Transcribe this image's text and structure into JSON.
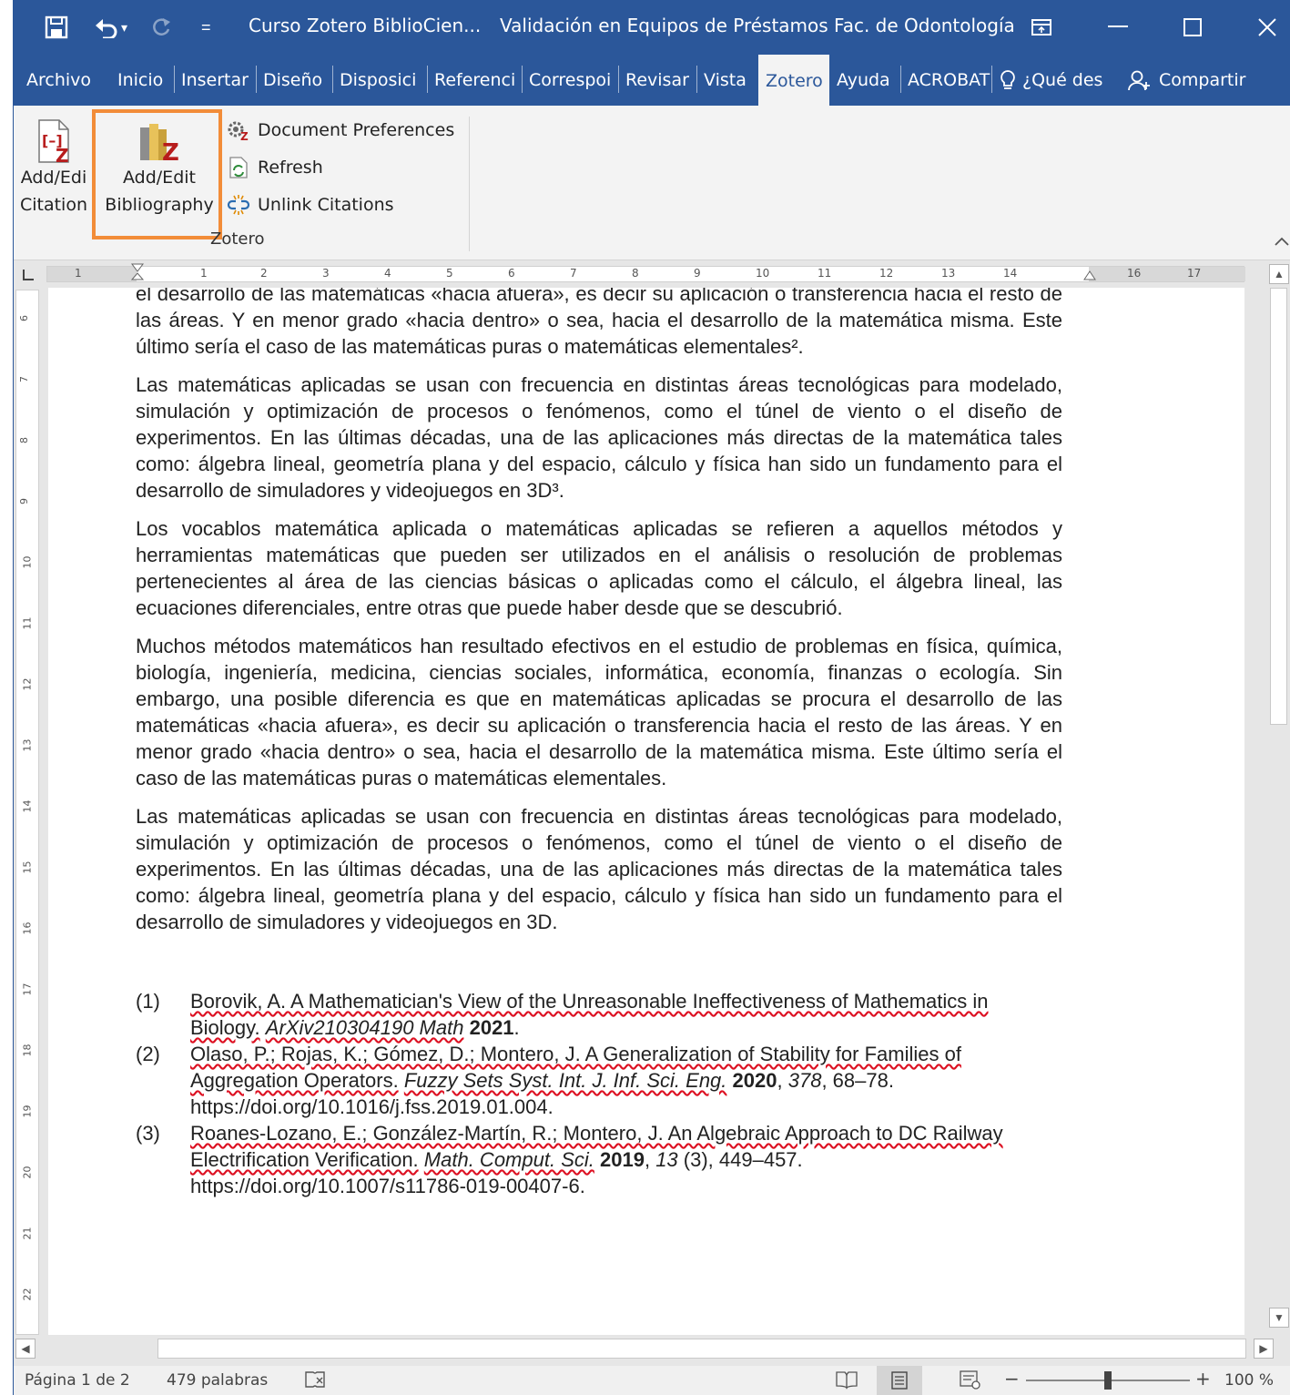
{
  "window": {
    "quick_access": {
      "undo_arrow": "▾",
      "customize": "="
    },
    "doc_title_1": "Curso Zotero BiblioCien...",
    "doc_title_2": "Validación en Equipos de Préstamos Fac. de Odontología",
    "colors": {
      "title_bar": "#2b579a",
      "highlight": "#f28c38"
    }
  },
  "tabs": [
    "Archivo",
    "Inicio",
    "Insertar",
    "Diseño",
    "Disposici",
    "Referenci",
    "Correspoi",
    "Revisar",
    "Vista",
    "Zotero",
    "Ayuda",
    "ACROBAT"
  ],
  "active_tab": "Zotero",
  "tell_me": "¿Qué des",
  "share": "Compartir",
  "ribbon": {
    "add_citation_l1": "Add/Edi",
    "add_citation_l2": "Citation",
    "add_bib_l1": "Add/Edit",
    "add_bib_l2": "Bibliography",
    "doc_prefs": "Document Preferences",
    "refresh": "Refresh",
    "unlink": "Unlink Citations",
    "group": "Zotero"
  },
  "ruler_ticks": [
    "1",
    "1",
    "2",
    "3",
    "4",
    "5",
    "6",
    "7",
    "8",
    "9",
    "10",
    "11",
    "12",
    "13",
    "14",
    "16",
    "17"
  ],
  "vruler_ticks": [
    "6",
    "7",
    "8",
    "9",
    "10",
    "11",
    "12",
    "13",
    "14",
    "15",
    "16",
    "17",
    "18",
    "19",
    "20",
    "21",
    "22"
  ],
  "document": {
    "paragraphs": [
      "el desarrollo de las matemáticas «hacia afuera», es decir su aplicación o transferencia hacia el resto de las áreas. Y en menor grado «hacia dentro» o sea, hacia el desarrollo de la matemática misma. Este último sería el caso de las matemáticas puras o matemáticas elementales².",
      "Las matemáticas aplicadas se usan con frecuencia en distintas áreas tecnológicas para modelado, simulación y optimización de procesos o fenómenos, como el túnel de viento o el diseño de experimentos. En las últimas décadas, una de las aplicaciones más directas de la matemática tales como: álgebra lineal, geometría plana y del espacio, cálculo y física han sido un fundamento para el desarrollo de simuladores y videojuegos en 3D³.",
      "Los vocablos matemática aplicada o matemáticas aplicadas se refieren a aquellos métodos y herramientas matemáticas que pueden ser utilizados en el análisis o resolución de problemas pertenecientes al área de las ciencias básicas o aplicadas como el cálculo, el álgebra lineal, las ecuaciones diferenciales, entre otras que puede haber desde que se descubrió.",
      "Muchos métodos matemáticos han resultado efectivos en el estudio de problemas en física, química, biología, ingeniería, medicina, ciencias sociales, informática, economía, finanzas o ecología. Sin embargo, una posible diferencia es que en matemáticas aplicadas se procura el desarrollo de las matemáticas «hacia afuera», es decir su aplicación o transferencia hacia el resto de las áreas. Y en menor grado «hacia dentro» o sea, hacia el desarrollo de la matemática misma. Este último sería el caso de las matemáticas puras o matemáticas elementales.",
      "Las matemáticas aplicadas se usan con frecuencia en distintas áreas tecnológicas para modelado, simulación y optimización de procesos o fenómenos, como el túnel de viento o el diseño de experimentos. En las últimas décadas, una de las aplicaciones más directas de la matemática tales como: álgebra lineal, geometría plana y del espacio, cálculo y física han sido un fundamento para el desarrollo de simuladores y videojuegos en 3D."
    ],
    "bibliography": [
      {
        "num": "(1)",
        "authors": "Borovik, A. A Mathematician's View of the Unreasonable Ineffectiveness of Mathematics in Biology.",
        "journal": "ArXiv210304190 Math",
        "year": "2021",
        "rest": "."
      },
      {
        "num": "(2)",
        "authors": "Olaso, P.; Rojas, K.; Gómez, D.; Montero, J. A Generalization of Stability for Families of Aggregation Operators.",
        "journal": "Fuzzy Sets Syst. Int. J. Inf. Sci. Eng.",
        "year": "2020",
        "volume": "378",
        "rest": ", 68–78. https://doi.org/10.1016/j.fss.2019.01.004."
      },
      {
        "num": "(3)",
        "authors": "Roanes-Lozano, E.; González-Martín, R.; Montero, J. An Algebraic Approach to DC Railway Electrification Verification.",
        "journal": "Math. Comput. Sci.",
        "year": "2019",
        "volume": "13",
        "rest": " (3), 449–457. https://doi.org/10.1007/s11786-019-00407-6."
      }
    ]
  },
  "status": {
    "page": "Página 1 de 2",
    "words": "479 palabras",
    "zoom": "100 %"
  }
}
